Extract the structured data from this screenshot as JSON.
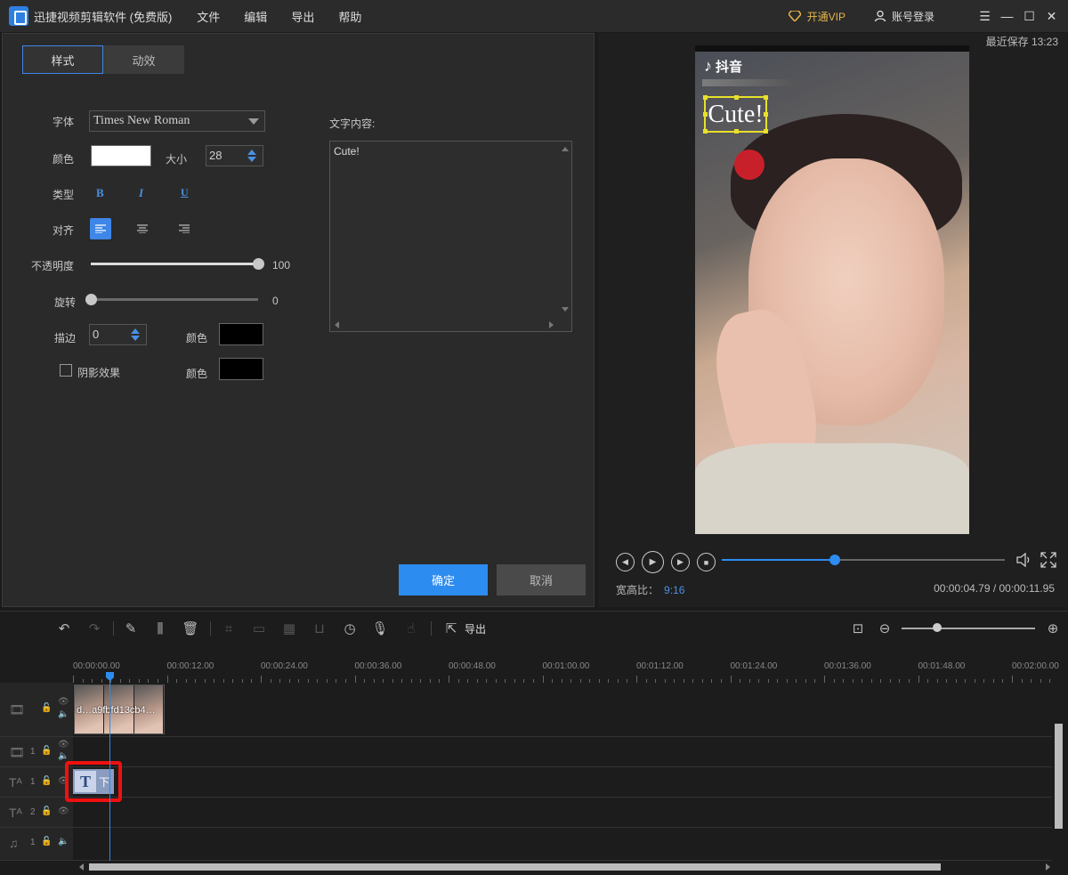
{
  "app": {
    "title": "迅捷视频剪辑软件 (免费版)"
  },
  "menu": [
    "文件",
    "编辑",
    "导出",
    "帮助"
  ],
  "header": {
    "vip_label": "开通VIP",
    "login_label": "账号登录"
  },
  "window_controls": [
    "☰",
    "—",
    "☐",
    "✕"
  ],
  "editor": {
    "tabs": [
      {
        "label": "样式",
        "active": true
      },
      {
        "label": "动效",
        "active": false
      }
    ],
    "font_label": "字体",
    "font_value": "Times New Roman",
    "color_label": "颜色",
    "color_value": "#ffffff",
    "size_label": "大小",
    "size_value": "28",
    "type_label": "类型",
    "bold": "B",
    "italic": "I",
    "underline": "U",
    "align_label": "对齐",
    "opacity_label": "不透明度",
    "opacity_value": "100",
    "rotate_label": "旋转",
    "rotate_value": "0",
    "stroke_label": "描边",
    "stroke_value": "0",
    "stroke_color_label": "颜色",
    "stroke_color": "#000000",
    "shadow_label": "阴影效果",
    "shadow_color_label": "颜色",
    "shadow_color": "#000000",
    "content_label": "文字内容:",
    "content_value": "Cute!",
    "ok_label": "确定",
    "cancel_label": "取消"
  },
  "preview": {
    "last_save": "最近保存 13:23",
    "platform_label": "抖音",
    "overlay_text": "Cute!",
    "ratio_label": "宽高比：",
    "ratio_value": "9:16",
    "timecode": "00:00:04.79 / 00:00:11.95",
    "progress": 0.4
  },
  "timeline": {
    "export_label": "导出",
    "ruler": [
      "00:00:00.00",
      "00:00:12.00",
      "00:00:24.00",
      "00:00:36.00",
      "00:00:48.00",
      "00:01:00.00",
      "00:01:12.00",
      "00:01:24.00",
      "00:01:36.00",
      "00:01:48.00",
      "00:02:00.00"
    ],
    "clip_label": "d…a9fbfd13cb4…",
    "text_clip_initial": "T",
    "text_clip_label": "下",
    "track_numbers": [
      "1",
      "1",
      "2",
      "1"
    ]
  }
}
